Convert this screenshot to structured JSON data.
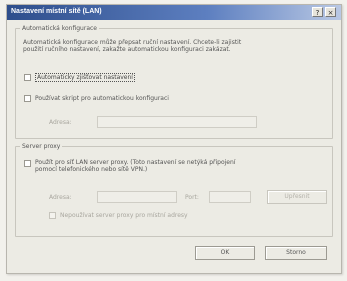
{
  "window": {
    "title": "Nastavení místní sítě (LAN)",
    "help_button": "?",
    "close_button": "×"
  },
  "auto_config": {
    "legend": "Automatická konfigurace",
    "description_line1": "Automatická konfigurace může přepsat ruční nastavení. Chcete-li zajistit",
    "description_line2": "použití ručního nastavení, zakažte automatickou konfiguraci zakázat.",
    "detect_label": "Automaticky zjišťovat nastavení",
    "script_label": "Používat skript pro automatickou konfiguraci",
    "address_label": "Adresa:",
    "address_value": ""
  },
  "proxy": {
    "legend": "Server proxy",
    "use_proxy_line1": "Použít pro síť LAN server proxy. (Toto nastavení se netýká připojení",
    "use_proxy_line2": "pomocí telefonického nebo sítě VPN.)",
    "address_label": "Adresa:",
    "address_value": "",
    "port_label": "Port:",
    "port_value": "",
    "advanced_button": "Upřesnit",
    "bypass_label": "Nepoužívat server proxy pro místní adresy"
  },
  "footer": {
    "ok_button": "OK",
    "cancel_button": "Storno"
  }
}
